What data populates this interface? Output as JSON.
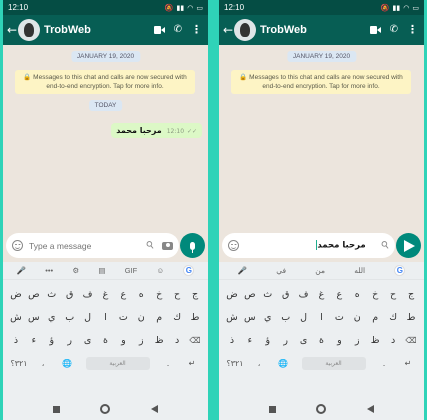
{
  "status_bar": {
    "time": "12:10",
    "battery": "20%"
  },
  "chat": {
    "contact_name": "TrobWeb",
    "date_chip": "JANUARY 19, 2020",
    "encryption_notice": "Messages to this chat and calls are now secured with end-to-end encryption. Tap for more info.",
    "today_chip": "TODAY",
    "outgoing_message": {
      "text": "مرحبا محمد",
      "time": "12:10"
    }
  },
  "left_screen": {
    "input_placeholder": "Type a message",
    "keyboard_toolbar": {
      "sticker": "☺",
      "more": "•••",
      "clipboard": "▤",
      "gif": "GIF",
      "settings": "⚙",
      "translate": "G"
    }
  },
  "right_screen": {
    "input_value": "مرحبا محمد",
    "suggestions": [
      "في",
      "من",
      "الله"
    ]
  },
  "keyboard": {
    "row1": [
      "ض",
      "ص",
      "ث",
      "ق",
      "ف",
      "غ",
      "ع",
      "ه",
      "خ",
      "ح",
      "ج"
    ],
    "row2": [
      "ش",
      "س",
      "ي",
      "ب",
      "ل",
      "ا",
      "ت",
      "ن",
      "م",
      "ك",
      "ط"
    ],
    "row3": [
      "ذ",
      "ء",
      "ؤ",
      "ر",
      "ى",
      "ة",
      "و",
      "ز",
      "ظ",
      "د"
    ],
    "numbers_key": "٣٢١؟",
    "comma_key": "،",
    "space_label": "العربية",
    "period_key": ".",
    "enter_key": "↵",
    "backspace_key": "⌫"
  },
  "colors": {
    "header": "#075e54",
    "statusbar": "#054d44",
    "accent": "#00897b",
    "bubble_out": "#dcf8c6",
    "divider": "#2fd3b8"
  }
}
